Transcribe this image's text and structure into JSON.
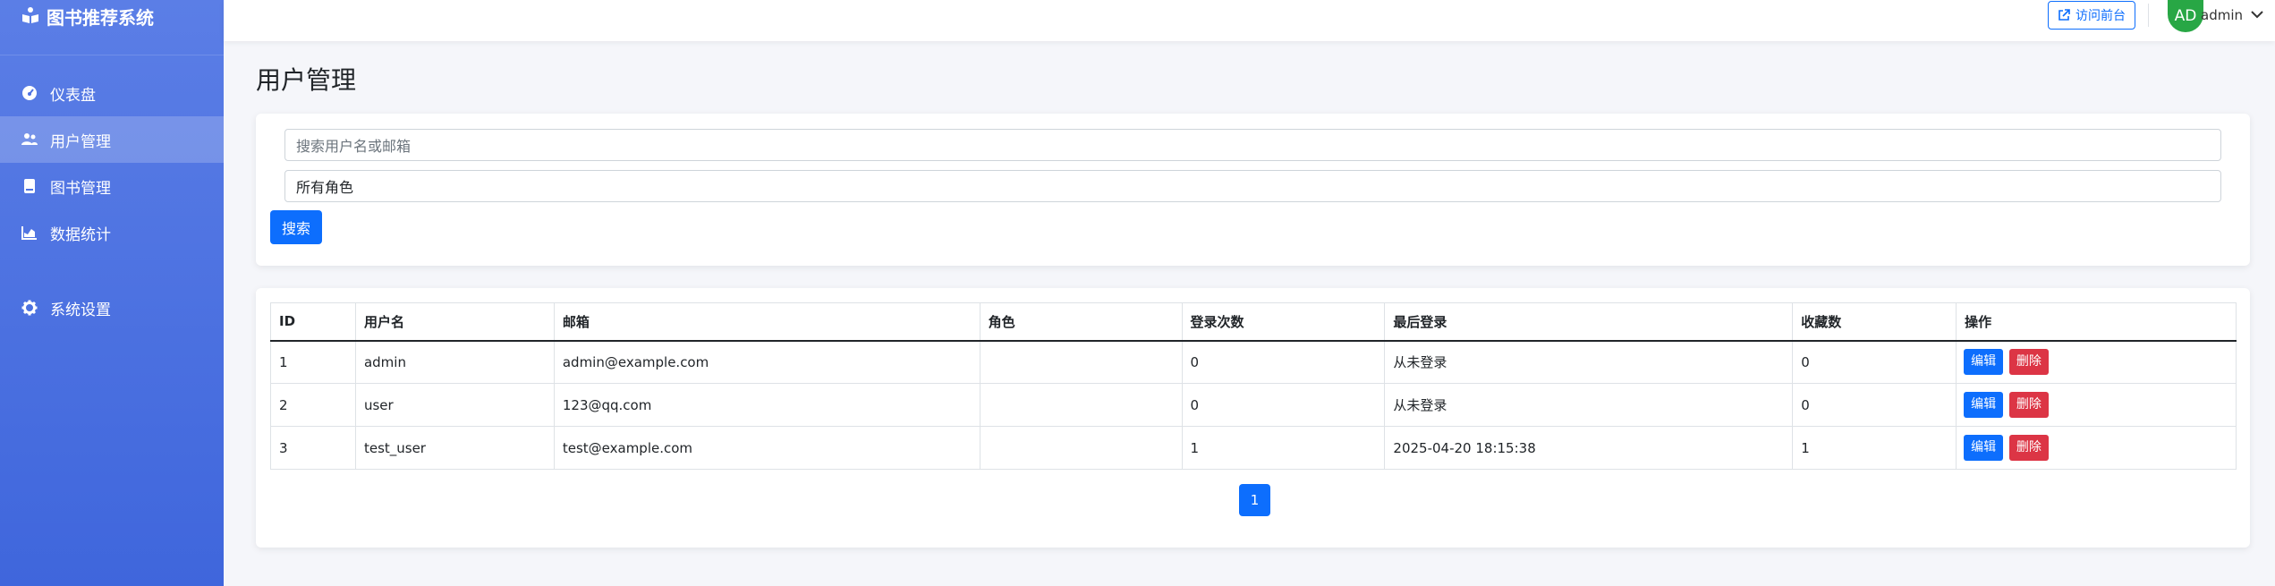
{
  "app": {
    "title": "图书推荐系统"
  },
  "sidebar": {
    "items": [
      {
        "label": "仪表盘",
        "icon": "dashboard-icon"
      },
      {
        "label": "用户管理",
        "icon": "users-icon",
        "active": true
      },
      {
        "label": "图书管理",
        "icon": "book-icon"
      },
      {
        "label": "数据统计",
        "icon": "chart-icon"
      },
      {
        "label": "系统设置",
        "icon": "gear-icon"
      }
    ]
  },
  "topbar": {
    "visit_label": "访问前台",
    "avatar_initials": "AD",
    "avatar_color": "#28a745",
    "username": "admin"
  },
  "page": {
    "title": "用户管理"
  },
  "search": {
    "placeholder": "搜索用户名或邮箱",
    "role_select_value": "所有角色",
    "button_label": "搜索"
  },
  "table": {
    "columns": [
      "ID",
      "用户名",
      "邮箱",
      "角色",
      "登录次数",
      "最后登录",
      "收藏数",
      "操作"
    ],
    "rows": [
      {
        "id": "1",
        "username": "admin",
        "email": "admin@example.com",
        "role": "",
        "login_count": "0",
        "last_login": "从未登录",
        "favorites": "0"
      },
      {
        "id": "2",
        "username": "user",
        "email": "123@qq.com",
        "role": "",
        "login_count": "0",
        "last_login": "从未登录",
        "favorites": "0"
      },
      {
        "id": "3",
        "username": "test_user",
        "email": "test@example.com",
        "role": "",
        "login_count": "1",
        "last_login": "2025-04-20 18:15:38",
        "favorites": "1"
      }
    ],
    "edit_label": "编辑",
    "delete_label": "删除"
  },
  "pagination": {
    "current_page": "1"
  },
  "colors": {
    "primary": "#0d6efd",
    "danger": "#dc3545",
    "sidebar_top": "#5b7ee6",
    "sidebar_bottom": "#3f66dc"
  }
}
